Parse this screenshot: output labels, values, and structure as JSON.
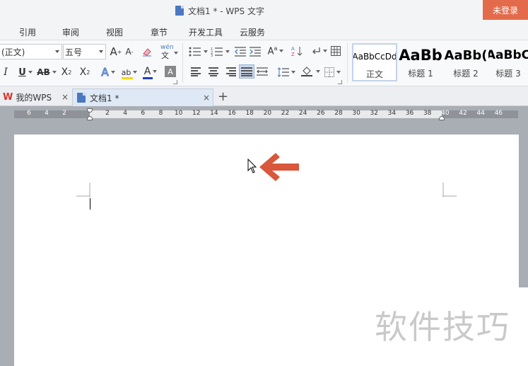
{
  "titlebar": {
    "doc_title": "文档1 * - WPS 文字",
    "login_label": "未登录"
  },
  "menu": [
    "引用",
    "审阅",
    "视图",
    "章节",
    "开发工具",
    "云服务"
  ],
  "ribbon": {
    "font_name": "(正文)",
    "font_size": "五号",
    "grow_font": "A",
    "shrink_font": "A",
    "pinyin": "wén",
    "italic": "I",
    "underline": "U",
    "strike": "AB",
    "superscript": "X",
    "subscript": "X",
    "text_effect": "A",
    "highlight": "ab",
    "font_color": "A",
    "char_shade": "A",
    "styles": [
      {
        "sample": "AaBbCcDd",
        "label": "正文"
      },
      {
        "sample": "AaBb",
        "label": "标题 1"
      },
      {
        "sample": "AaBb(",
        "label": "标题 2"
      },
      {
        "sample": "AaBbC",
        "label": "标题 3"
      }
    ]
  },
  "tabs": {
    "home": "我的WPS",
    "doc": "文档1 *",
    "close": "×",
    "add": "+"
  },
  "ruler": {
    "left_numbers": [
      "6",
      "4",
      "2"
    ],
    "main_numbers": [
      "2",
      "4",
      "6",
      "8",
      "10",
      "12",
      "14",
      "16",
      "18",
      "20",
      "22",
      "24",
      "26",
      "28",
      "30",
      "32",
      "34",
      "36",
      "38",
      "40",
      "42",
      "44",
      "46"
    ]
  },
  "watermark": "软件技巧",
  "colors": {
    "accent": "#e36b4b",
    "arrow": "#d9573a",
    "font_color_bar": "#1f3fbf",
    "highlight_bar": "#ffd400"
  }
}
